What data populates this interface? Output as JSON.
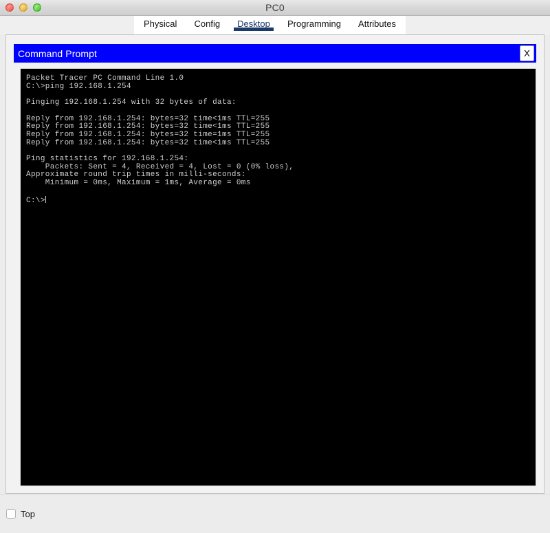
{
  "window": {
    "title": "PC0",
    "controls": {
      "close": "close-button",
      "minimize": "minimize-button",
      "maximize": "maximize-button"
    }
  },
  "tabs": {
    "items": [
      {
        "label": "Physical",
        "active": false
      },
      {
        "label": "Config",
        "active": false
      },
      {
        "label": "Desktop",
        "active": true
      },
      {
        "label": "Programming",
        "active": false
      },
      {
        "label": "Attributes",
        "active": false
      }
    ],
    "active_label": "Desktop"
  },
  "command_prompt": {
    "title": "Command Prompt",
    "close_label": "X",
    "background_color": "#000000",
    "titlebar_color": "#0000FF",
    "text_color": "#CFCFCF",
    "lines": [
      "Packet Tracer PC Command Line 1.0",
      "C:\\>ping 192.168.1.254",
      "",
      "Pinging 192.168.1.254 with 32 bytes of data:",
      "",
      "Reply from 192.168.1.254: bytes=32 time<1ms TTL=255",
      "Reply from 192.168.1.254: bytes=32 time<1ms TTL=255",
      "Reply from 192.168.1.254: bytes=32 time=1ms TTL=255",
      "Reply from 192.168.1.254: bytes=32 time<1ms TTL=255",
      "",
      "Ping statistics for 192.168.1.254:",
      "    Packets: Sent = 4, Received = 4, Lost = 0 (0% loss),",
      "Approximate round trip times in milli-seconds:",
      "    Minimum = 0ms, Maximum = 1ms, Average = 0ms",
      "",
      "C:\\>"
    ],
    "prompt_text": "C:\\>"
  },
  "bottom_bar": {
    "checkbox": {
      "label": "Top",
      "checked": false
    }
  }
}
